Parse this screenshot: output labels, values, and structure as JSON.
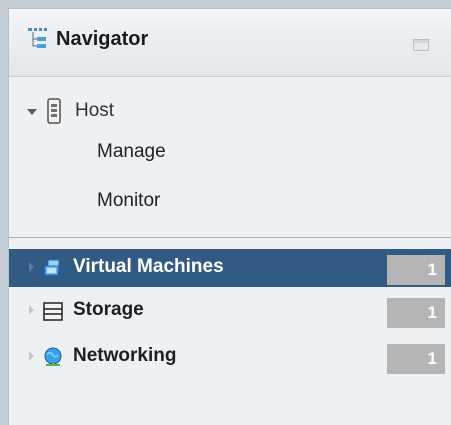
{
  "navigator": {
    "title": "Navigator",
    "host": {
      "label": "Host",
      "expanded": true,
      "children": [
        {
          "label": "Manage"
        },
        {
          "label": "Monitor"
        }
      ]
    },
    "items": [
      {
        "label": "Virtual Machines",
        "count": "1",
        "selected": true,
        "icon": "virtual-machines-icon"
      },
      {
        "label": "Storage",
        "count": "1",
        "selected": false,
        "icon": "storage-icon"
      },
      {
        "label": "Networking",
        "count": "1",
        "selected": false,
        "icon": "networking-icon"
      }
    ]
  },
  "colors": {
    "selected_row": "#315a85",
    "count_badge": "#b5b5b5",
    "panel_background": "#eef1f3"
  }
}
